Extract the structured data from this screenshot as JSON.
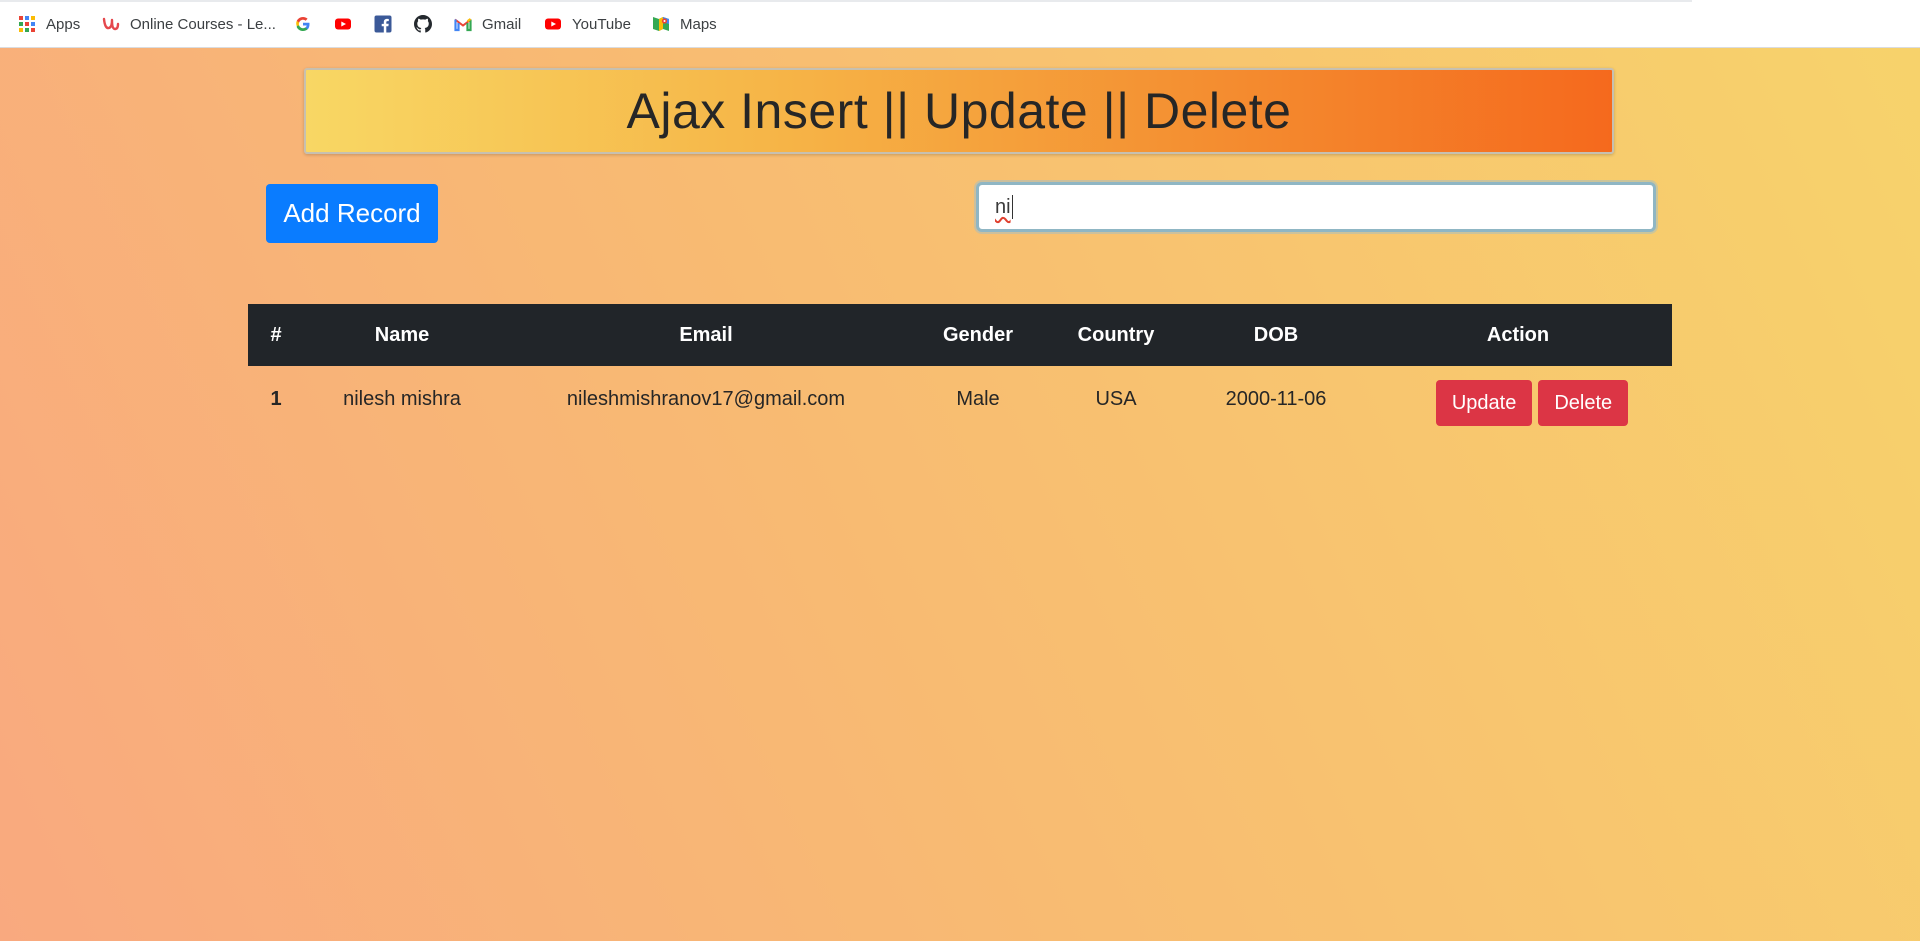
{
  "bookmarks": [
    {
      "icon": "apps-grid-icon",
      "label": "Apps"
    },
    {
      "icon": "udemy-icon",
      "label": "Online Courses - Le..."
    },
    {
      "icon": "google-icon",
      "label": ""
    },
    {
      "icon": "youtube-icon",
      "label": ""
    },
    {
      "icon": "facebook-icon",
      "label": ""
    },
    {
      "icon": "github-icon",
      "label": ""
    },
    {
      "icon": "gmail-icon",
      "label": "Gmail"
    },
    {
      "icon": "youtube-icon",
      "label": "YouTube"
    },
    {
      "icon": "maps-icon",
      "label": "Maps"
    }
  ],
  "page": {
    "title": "Ajax Insert || Update || Delete",
    "add_button": "Add Record",
    "search": {
      "value": "ni",
      "placeholder": ""
    }
  },
  "table": {
    "headers": [
      "#",
      "Name",
      "Email",
      "Gender",
      "Country",
      "DOB",
      "Action"
    ],
    "rows": [
      {
        "id": "1",
        "name": "nilesh mishra",
        "email": "nileshmishranov17@gmail.com",
        "gender": "Male",
        "country": "USA",
        "dob": "2000-11-06",
        "update_label": "Update",
        "delete_label": "Delete"
      }
    ]
  },
  "colors": {
    "primary": "#0a7cff",
    "danger": "#dc3545",
    "table_header": "#212529",
    "background_left": "#f9a97f",
    "background_right": "#f7d36b"
  }
}
